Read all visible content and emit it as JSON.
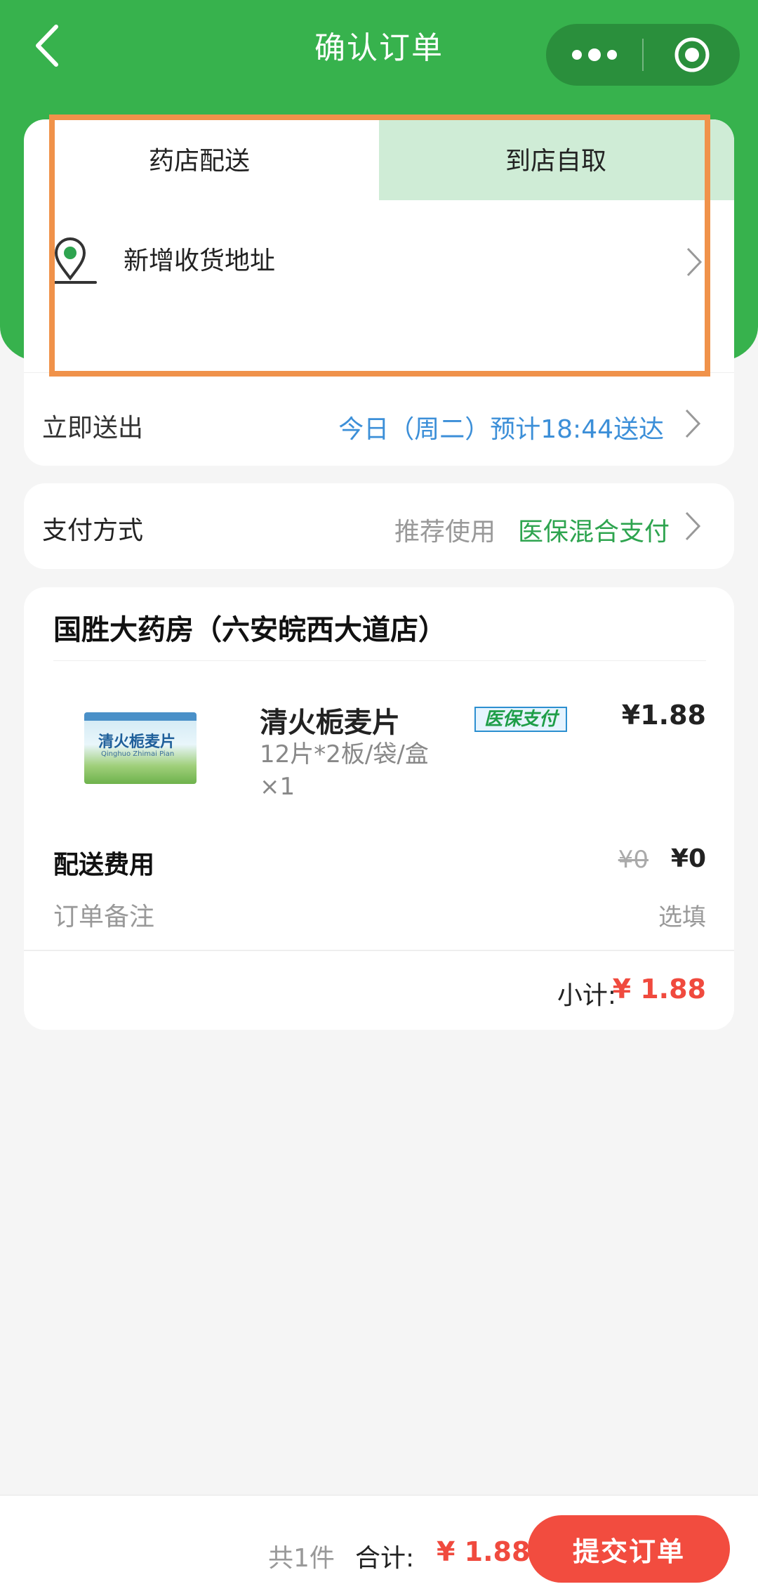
{
  "nav": {
    "title": "确认订单",
    "back_icon": "chevron-left-icon",
    "more_icon": "more-dots-icon",
    "close_icon": "target-close-icon"
  },
  "delivery": {
    "tabs": [
      {
        "label": "药店配送",
        "selected": true
      },
      {
        "label": "到店自取",
        "selected": false
      }
    ],
    "address_label": "新增收货地址",
    "address_icon": "location-pin-icon",
    "ship_label": "立即送出",
    "ship_time": "今日（周二）预计18:44送达"
  },
  "payment": {
    "label": "支付方式",
    "hint": "推荐使用",
    "method": "医保混合支付"
  },
  "store": {
    "name": "国胜大药房（六安皖西大道店）",
    "product": {
      "name": "清火栀麦片",
      "spec": "12片*2板/袋/盒",
      "qty": "×1",
      "badge": "医保支付",
      "price": "¥1.88",
      "image_title": "清火栀麦片",
      "image_sub": "Qinghuo Zhimai Pian"
    },
    "fee_label": "配送费用",
    "fee_original": "¥0",
    "fee_now": "¥0",
    "remark_label": "订单备注",
    "remark_hint": "选填",
    "subtotal_label": "小计:",
    "subtotal_value": "¥ 1.88"
  },
  "footer": {
    "count": "共1件",
    "total_label": "合计:",
    "total_value": "¥ 1.88",
    "submit_label": "提交订单"
  },
  "colors": {
    "brand_green": "#37b24d",
    "accent_red": "#f24c3f",
    "link_blue": "#3c8fd8",
    "highlight_orange": "#f0924a"
  }
}
